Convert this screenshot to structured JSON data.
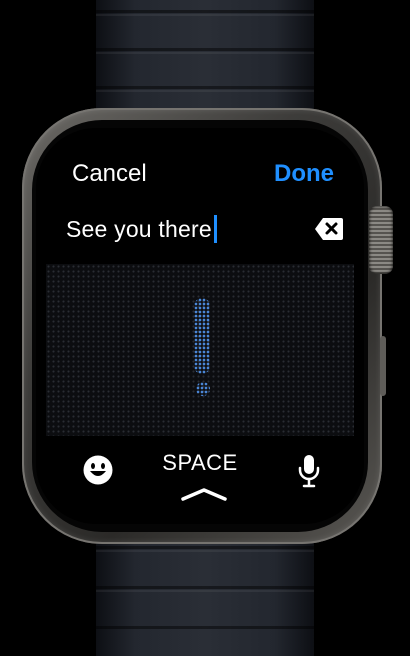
{
  "header": {
    "cancel_label": "Cancel",
    "done_label": "Done"
  },
  "text_field": {
    "value": "See you there"
  },
  "icons": {
    "delete": "delete-backward-icon",
    "emoji": "emoji-icon",
    "mic": "microphone-icon",
    "chevron": "chevron-up-icon"
  },
  "keyboard": {
    "space_label": "SPACE"
  },
  "colors": {
    "accent": "#1f8fff",
    "scribble_ink": "#4a86d6",
    "background": "#000000",
    "text": "#ffffff"
  }
}
